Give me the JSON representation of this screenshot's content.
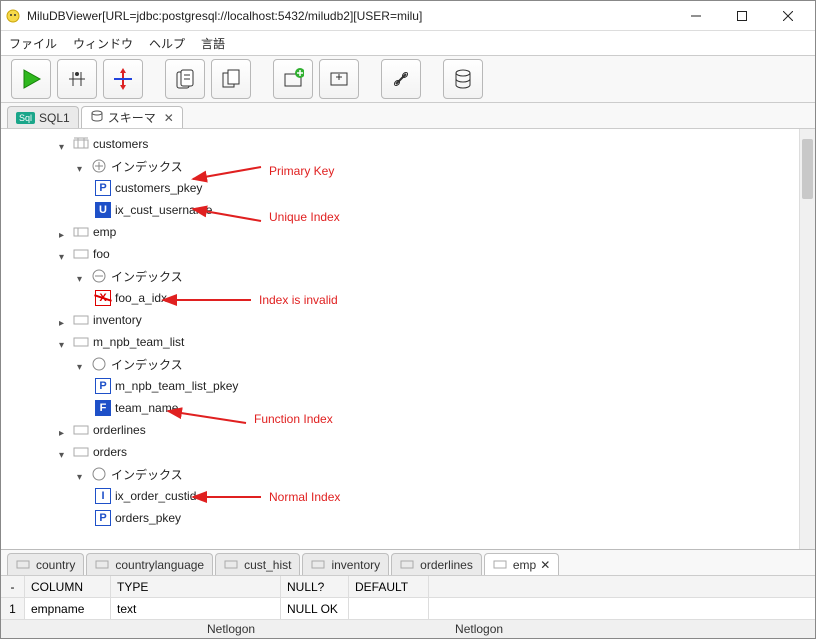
{
  "window": {
    "title": "MiluDBViewer[URL=jdbc:postgresql://localhost:5432/miludb2][USER=milu]"
  },
  "menu": {
    "file": "ファイル",
    "window": "ウィンドウ",
    "help": "ヘルプ",
    "language": "言語"
  },
  "tabs": {
    "sql": {
      "label": "SQL1"
    },
    "schema": {
      "label": "スキーマ"
    }
  },
  "tree": {
    "customers": {
      "name": "customers",
      "index_group": "インデックス",
      "idx_pkey": "customers_pkey",
      "idx_unique": "ix_cust_username"
    },
    "emp": {
      "name": "emp"
    },
    "foo": {
      "name": "foo",
      "index_group": "インデックス",
      "idx_invalid": "foo_a_idx"
    },
    "inventory": {
      "name": "inventory"
    },
    "m_npb": {
      "name": "m_npb_team_list",
      "index_group": "インデックス",
      "idx_pkey": "m_npb_team_list_pkey",
      "idx_func": "team_name"
    },
    "orderlines": {
      "name": "orderlines"
    },
    "orders": {
      "name": "orders",
      "index_group": "インデックス",
      "idx_normal": "ix_order_custid",
      "idx_pkey": "orders_pkey"
    }
  },
  "annotations": {
    "primary_key": "Primary Key",
    "unique_index": "Unique Index",
    "invalid": "Index is invalid",
    "function_index": "Function Index",
    "normal_index": "Normal Index"
  },
  "bottom_tabs": {
    "country": "country",
    "countrylanguage": "countrylanguage",
    "cust_hist": "cust_hist",
    "inventory": "inventory",
    "orderlines": "orderlines",
    "emp": "emp"
  },
  "grid": {
    "headers": {
      "column": "COLUMN",
      "type": "TYPE",
      "null": "NULL?",
      "default": "DEFAULT"
    },
    "row1": {
      "num": "1",
      "column": "empname",
      "type": "text",
      "null": "NULL OK",
      "default": ""
    }
  },
  "status": {
    "left": "",
    "mid": "Netlogon",
    "right": "Netlogon"
  }
}
